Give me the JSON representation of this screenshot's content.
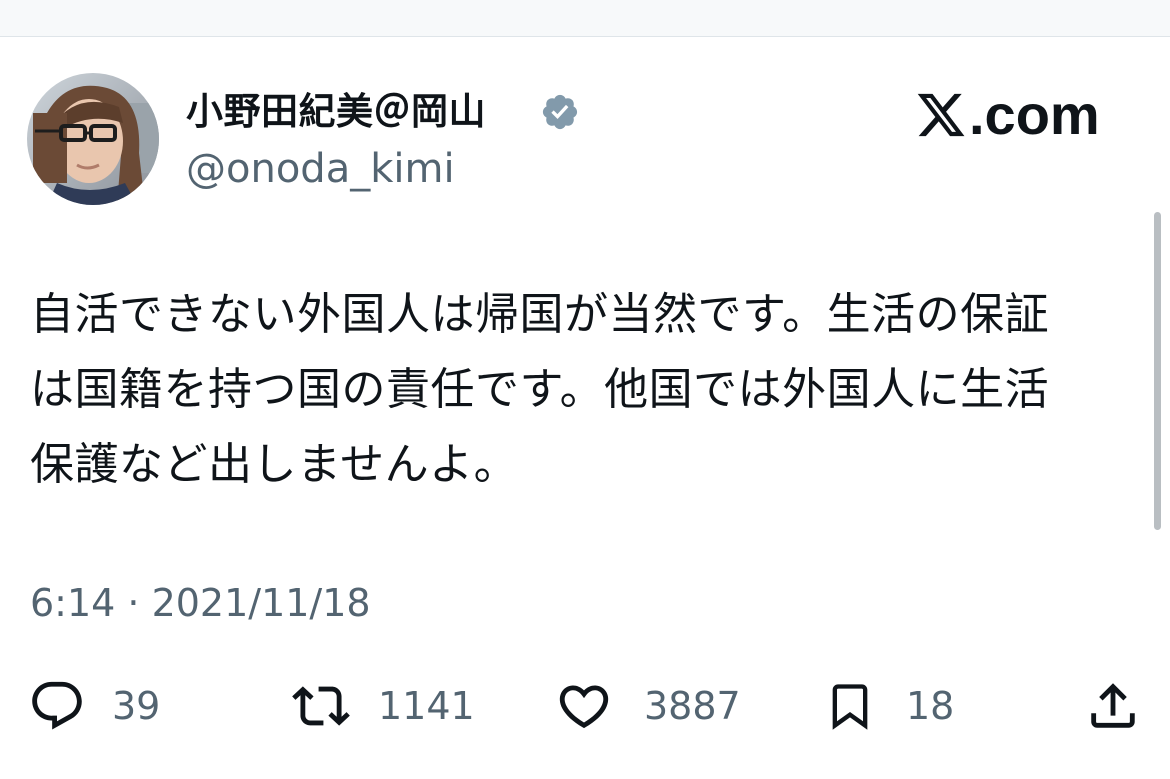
{
  "author": {
    "display_name": "小野田紀美＠岡山",
    "handle": "@onoda_kimi",
    "verified": true,
    "avatar": "profile-photo"
  },
  "brand": {
    "label": ".com",
    "icon": "x-logo-icon"
  },
  "tweet": {
    "lines": [
      "自活できない外国人は帰国が当然です。生活の保証",
      "は国籍を持つ国の責任です。他国では外国人に生活",
      "保護など出しませんよ。"
    ],
    "timestamp": "6:14 · 2021/11/18"
  },
  "actions": {
    "reply": {
      "icon": "reply-icon",
      "count": "39"
    },
    "retweet": {
      "icon": "retweet-icon",
      "count": "1141"
    },
    "like": {
      "icon": "heart-icon",
      "count": "3887"
    },
    "bookmark": {
      "icon": "bookmark-icon",
      "count": "18"
    },
    "share": {
      "icon": "share-icon"
    }
  },
  "colors": {
    "text": "#0f1419",
    "secondary": "#536471",
    "verified_badge": "#829aab"
  }
}
